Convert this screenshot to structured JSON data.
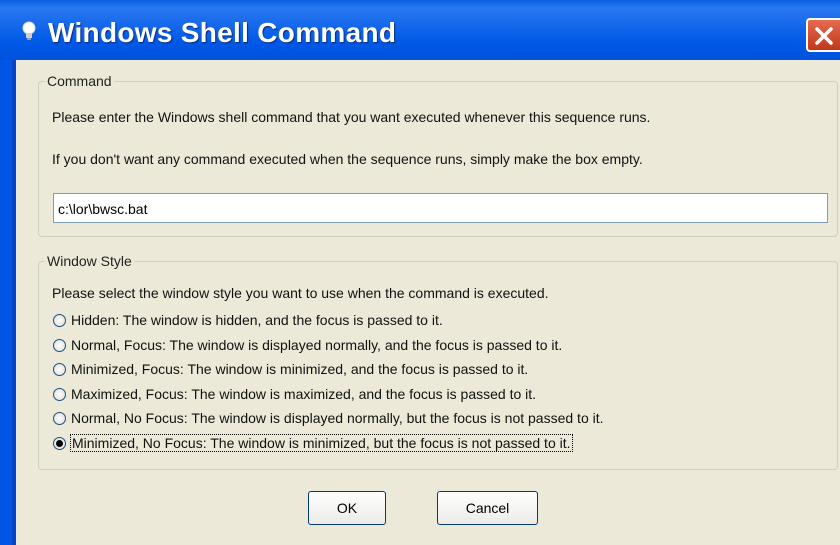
{
  "window": {
    "title": "Windows Shell Command"
  },
  "command_group": {
    "legend": "Command",
    "line1": "Please enter the Windows shell command that you want executed whenever this sequence runs.",
    "line2": "If you don't want any command executed when the sequence runs, simply make the box empty.",
    "value": "c:\\lor\\bwsc.bat"
  },
  "window_style_group": {
    "legend": "Window Style",
    "instruction": "Please select the window style you want to use when the command is executed.",
    "options": [
      {
        "label": "Hidden: The window is hidden, and the focus is passed to it.",
        "selected": false
      },
      {
        "label": "Normal, Focus: The window is displayed normally, and the focus is passed to it.",
        "selected": false
      },
      {
        "label": "Minimized, Focus: The window is minimized, and the focus is passed to it.",
        "selected": false
      },
      {
        "label": "Maximized, Focus: The window is maximized, and the focus is passed to it.",
        "selected": false
      },
      {
        "label": "Normal, No Focus: The window is displayed normally, but the focus is not passed to it.",
        "selected": false
      },
      {
        "label": "Minimized, No Focus: The window is minimized, but the focus is not passed to it.",
        "selected": true
      }
    ]
  },
  "buttons": {
    "ok": "OK",
    "cancel": "Cancel"
  },
  "icons": {
    "title": "lightbulb-icon",
    "close": "close-icon"
  },
  "colors": {
    "titlebar": "#0058e6",
    "close": "#d9452a",
    "dialog_bg": "#ece9d8"
  }
}
